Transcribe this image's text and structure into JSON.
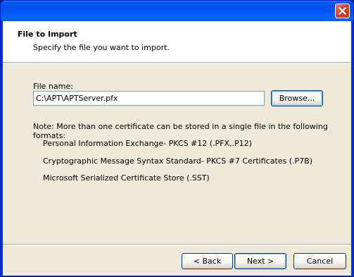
{
  "header": {
    "title": "File to Import",
    "subtitle": "Specify the file you want to import."
  },
  "file": {
    "label": "File name:",
    "value": "C:\\APT\\APTServer.pfx",
    "browse_label": "Browse..."
  },
  "note": {
    "text": "Note:  More than one certificate can be stored in a single file in the following formats:",
    "formats": [
      "Personal Information Exchange- PKCS #12 (.PFX,.P12)",
      "Cryptographic Message Syntax Standard- PKCS #7 Certificates (.P7B)",
      "Microsoft Serialized Certificate Store (.SST)"
    ]
  },
  "buttons": {
    "back": "< Back",
    "next": "Next >",
    "cancel": "Cancel"
  },
  "colors": {
    "titlebar": "#0054e3",
    "close_button": "#d5442b",
    "dialog_background": "#ece9d8",
    "header_background": "#ffffff"
  },
  "icons": {
    "close": "close-icon"
  }
}
